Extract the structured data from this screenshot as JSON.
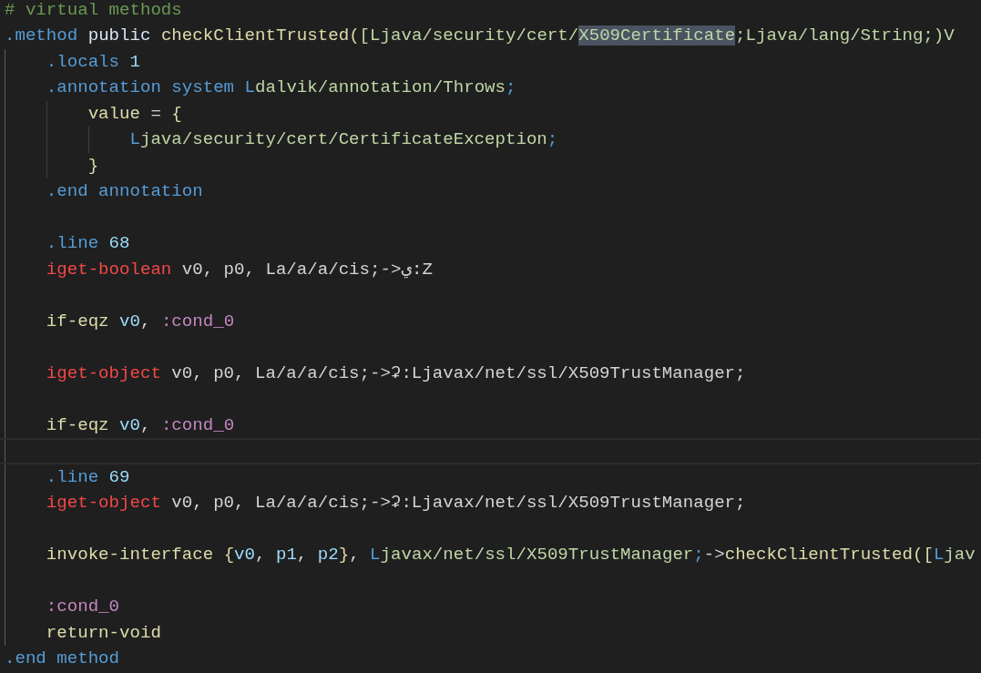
{
  "editor": {
    "lines": [
      {
        "kind": "code",
        "current": false,
        "tokens": [
          {
            "text": "# virtual methods",
            "kind": "comment",
            "selected": false
          }
        ]
      },
      {
        "kind": "code",
        "current": false,
        "tokens": [
          {
            "text": ".method ",
            "kind": "directive",
            "selected": false
          },
          {
            "text": "public ",
            "kind": "modifier",
            "selected": false
          },
          {
            "text": "checkClientTrusted(",
            "kind": "method",
            "selected": false
          },
          {
            "text": "[Ljava/security/cert/",
            "kind": "type",
            "selected": false
          },
          {
            "text": "X509Certificate",
            "kind": "type",
            "selected": true
          },
          {
            "text": ";Ljava/lang/String;)V",
            "kind": "type",
            "selected": false
          }
        ],
        "children": [
          {
            "kind": "code",
            "current": false,
            "tokens": [
              {
                "text": ".locals ",
                "kind": "directive",
                "selected": false
              },
              {
                "text": "1",
                "kind": "number",
                "selected": false
              }
            ]
          },
          {
            "kind": "code",
            "current": false,
            "tokens": [
              {
                "text": ".annotation system ",
                "kind": "directive",
                "selected": false
              },
              {
                "text": "L",
                "kind": "type_delimiter",
                "selected": false
              },
              {
                "text": "dalvik/annotation/Throws",
                "kind": "type",
                "selected": false
              },
              {
                "text": ";",
                "kind": "type_delimiter",
                "selected": false
              }
            ],
            "children": [
              {
                "kind": "code",
                "current": false,
                "tokens": [
                  {
                    "text": "value",
                    "kind": "name",
                    "selected": false
                  },
                  {
                    "text": " = ",
                    "kind": "plain",
                    "selected": false
                  },
                  {
                    "text": "{",
                    "kind": "brace",
                    "selected": false
                  }
                ],
                "children": [
                  {
                    "kind": "code",
                    "current": false,
                    "tokens": [
                      {
                        "text": "L",
                        "kind": "type_delimiter",
                        "selected": false
                      },
                      {
                        "text": "java/security/cert/CertificateException",
                        "kind": "type",
                        "selected": false
                      },
                      {
                        "text": ";",
                        "kind": "type_delimiter",
                        "selected": false
                      }
                    ]
                  }
                ]
              },
              {
                "kind": "code",
                "current": false,
                "tokens": [
                  {
                    "text": "}",
                    "kind": "brace",
                    "selected": false
                  }
                ]
              }
            ]
          },
          {
            "kind": "code",
            "current": false,
            "tokens": [
              {
                "text": ".end annotation",
                "kind": "directive",
                "selected": false
              }
            ]
          },
          {
            "kind": "blank",
            "current": false
          },
          {
            "kind": "code",
            "current": false,
            "tokens": [
              {
                "text": ".line ",
                "kind": "directive",
                "selected": false
              },
              {
                "text": "68",
                "kind": "number",
                "selected": false
              }
            ]
          },
          {
            "kind": "code",
            "current": false,
            "tokens": [
              {
                "text": "iget-boolean",
                "kind": "field_access",
                "selected": false
              },
              {
                "text": " v0, p0, La/a/a/cis;->ي:Z",
                "kind": "plain",
                "selected": false
              }
            ]
          },
          {
            "kind": "blank",
            "current": false
          },
          {
            "kind": "code",
            "current": false,
            "tokens": [
              {
                "text": "if-eqz ",
                "kind": "instruction",
                "selected": false
              },
              {
                "text": "v0",
                "kind": "register",
                "selected": false
              },
              {
                "text": ", ",
                "kind": "plain",
                "selected": false
              },
              {
                "text": ":cond_0",
                "kind": "label",
                "selected": false
              }
            ]
          },
          {
            "kind": "blank",
            "current": false
          },
          {
            "kind": "code",
            "current": false,
            "tokens": [
              {
                "text": "iget-object",
                "kind": "field_access",
                "selected": false
              },
              {
                "text": " v0, p0, La/a/a/cis;->ʡ:Ljavax/net/ssl/X509TrustManager;",
                "kind": "plain",
                "selected": false
              }
            ]
          },
          {
            "kind": "blank",
            "current": false
          },
          {
            "kind": "code",
            "current": false,
            "tokens": [
              {
                "text": "if-eqz ",
                "kind": "instruction",
                "selected": false
              },
              {
                "text": "v0",
                "kind": "register",
                "selected": false
              },
              {
                "text": ", ",
                "kind": "plain",
                "selected": false
              },
              {
                "text": ":cond_0",
                "kind": "label",
                "selected": false
              }
            ]
          },
          {
            "kind": "blank",
            "current": true
          },
          {
            "kind": "code",
            "current": false,
            "tokens": [
              {
                "text": ".line ",
                "kind": "directive",
                "selected": false
              },
              {
                "text": "69",
                "kind": "number",
                "selected": false
              }
            ]
          },
          {
            "kind": "code",
            "current": false,
            "tokens": [
              {
                "text": "iget-object",
                "kind": "field_access",
                "selected": false
              },
              {
                "text": " v0, p0, La/a/a/cis;->ʡ:Ljavax/net/ssl/X509TrustManager;",
                "kind": "plain",
                "selected": false
              }
            ]
          },
          {
            "kind": "blank",
            "current": false
          },
          {
            "kind": "code",
            "current": false,
            "tokens": [
              {
                "text": "invoke-interface ",
                "kind": "instruction",
                "selected": false
              },
              {
                "text": "{",
                "kind": "brace",
                "selected": false
              },
              {
                "text": "v0",
                "kind": "register",
                "selected": false
              },
              {
                "text": ", ",
                "kind": "plain",
                "selected": false
              },
              {
                "text": "p1",
                "kind": "register",
                "selected": false
              },
              {
                "text": ", ",
                "kind": "plain",
                "selected": false
              },
              {
                "text": "p2",
                "kind": "register",
                "selected": false
              },
              {
                "text": "}",
                "kind": "brace",
                "selected": false
              },
              {
                "text": ", ",
                "kind": "plain",
                "selected": false
              },
              {
                "text": "L",
                "kind": "type_delimiter",
                "selected": false
              },
              {
                "text": "javax/net/ssl/X509TrustManager",
                "kind": "type",
                "selected": false
              },
              {
                "text": ";",
                "kind": "type_delimiter",
                "selected": false
              },
              {
                "text": "->",
                "kind": "plain",
                "selected": false
              },
              {
                "text": "checkClientTrusted([",
                "kind": "method",
                "selected": false
              },
              {
                "text": "L",
                "kind": "type_delimiter",
                "selected": false
              },
              {
                "text": "jav",
                "kind": "type",
                "selected": false
              }
            ]
          },
          {
            "kind": "blank",
            "current": false
          },
          {
            "kind": "code",
            "current": false,
            "tokens": [
              {
                "text": ":cond_0",
                "kind": "label",
                "selected": false
              }
            ]
          },
          {
            "kind": "code",
            "current": false,
            "tokens": [
              {
                "text": "return-void",
                "kind": "instruction",
                "selected": false
              }
            ]
          }
        ]
      },
      {
        "kind": "code",
        "current": false,
        "tokens": [
          {
            "text": ".end method",
            "kind": "directive",
            "selected": false
          }
        ]
      }
    ]
  }
}
